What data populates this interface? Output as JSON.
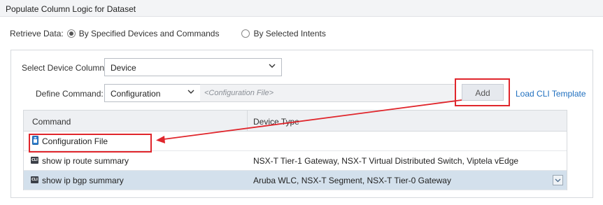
{
  "window": {
    "title": "Populate Column Logic for Dataset"
  },
  "retrieve": {
    "label": "Retrieve Data:",
    "options": [
      {
        "label": "By Specified Devices and Commands",
        "selected": true
      },
      {
        "label": "By Selected Intents",
        "selected": false
      }
    ]
  },
  "device_column": {
    "label": "Select Device Column:",
    "value": "Device"
  },
  "define_command": {
    "label": "Define Command:",
    "type_value": "Configuration",
    "placeholder": "<Configuration File>",
    "add_label": "Add",
    "load_template_label": "Load CLI Template"
  },
  "table": {
    "columns": [
      "Command",
      "Device Type"
    ],
    "rows": [
      {
        "icon": "config-file-icon",
        "command": "Configuration File",
        "device_type": "",
        "selected": false
      },
      {
        "icon": "cli-icon",
        "icon_text": "CLI",
        "command": "show ip route summary",
        "device_type": "NSX-T Tier-1 Gateway, NSX-T Virtual Distributed Switch, Viptela vEdge",
        "selected": false
      },
      {
        "icon": "cli-icon",
        "icon_text": "CLI",
        "command": "show ip bgp summary",
        "device_type": "Aruba WLC, NSX-T Segment, NSX-T Tier-0 Gateway",
        "selected": true
      }
    ]
  },
  "colors": {
    "highlight": "#e0262c",
    "link": "#1f6fbf",
    "selected_row": "#d3e0ec"
  }
}
